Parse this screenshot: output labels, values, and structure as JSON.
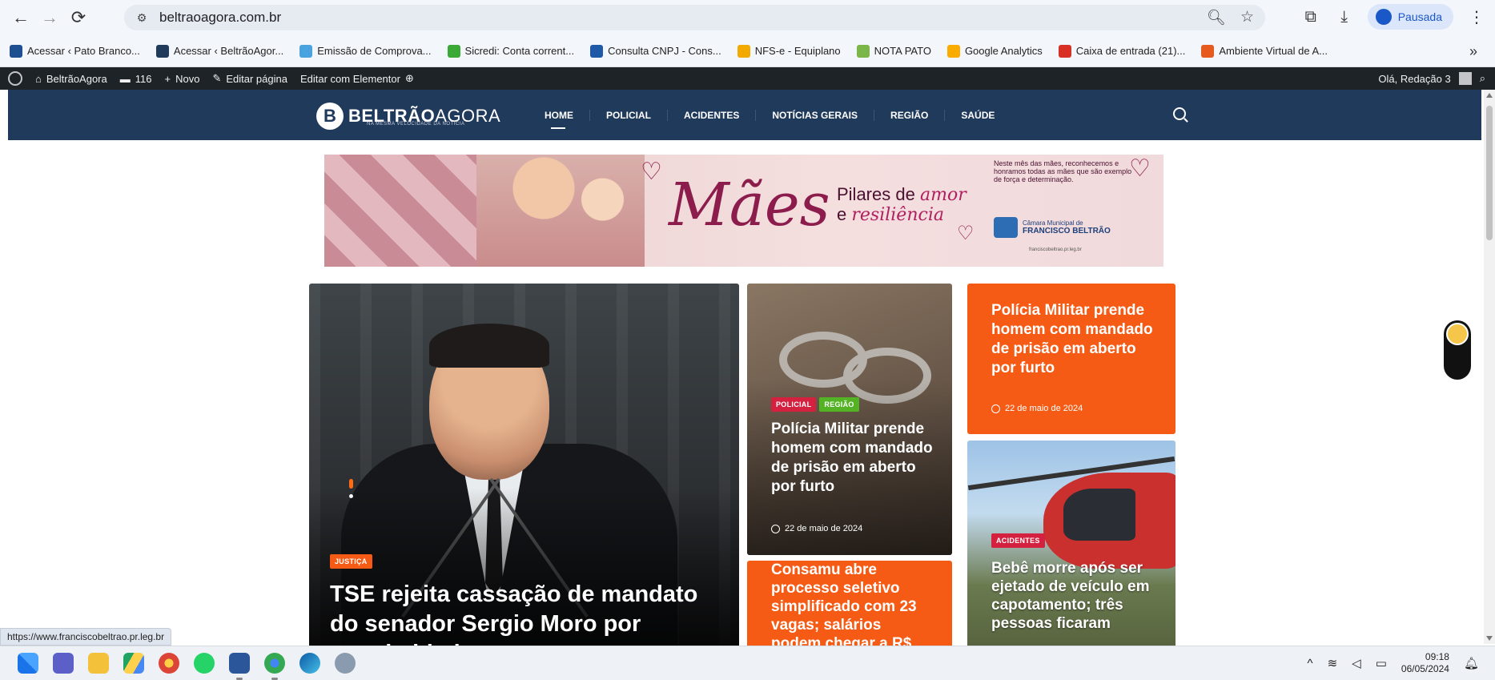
{
  "browser": {
    "url": "beltraoagora.com.br",
    "profile_label": "Pausada",
    "bookmarks": [
      {
        "label": "Acessar ‹ Pato Branco...",
        "color": "#1d4f91"
      },
      {
        "label": "Acessar ‹ BeltrãoAgor...",
        "color": "#203a5c"
      },
      {
        "label": "Emissão de Comprova...",
        "color": "#4aa3df"
      },
      {
        "label": "Sicredi: Conta corrent...",
        "color": "#3aa935"
      },
      {
        "label": "Consulta CNPJ - Cons...",
        "color": "#1e5aa8"
      },
      {
        "label": "NFS-e - Equiplano",
        "color": "#f2a900"
      },
      {
        "label": "NOTA PATO",
        "color": "#7ab648"
      },
      {
        "label": "Google Analytics",
        "color": "#f9ab00"
      },
      {
        "label": "Caixa de entrada (21)...",
        "color": "#d93025"
      },
      {
        "label": "Ambiente Virtual de A...",
        "color": "#e65a1e"
      }
    ]
  },
  "adminbar": {
    "site": "BeltrãoAgora",
    "comments": "116",
    "new": "Novo",
    "edit": "Editar página",
    "elementor": "Editar com Elementor",
    "greeting": "Olá, Redação 3"
  },
  "site": {
    "logo_bold": "BELTRÃO",
    "logo_light": "AGORA",
    "tagline": "NA MESMA VELOCIDADE DA NOTÍCIA",
    "menu": [
      "HOME",
      "POLICIAL",
      "ACIDENTES",
      "NOTÍCIAS GERAIS",
      "REGIÃO",
      "SAÚDE"
    ]
  },
  "banner": {
    "big_word": "Mães",
    "pilares": "Pilares de",
    "amor": "amor",
    "e": "e",
    "resiliencia": "resiliência",
    "description": "Neste mês das mães, reconhecemos e honramos todas as mães que são exemplo de força e determinação.",
    "seal_small": "Câmara Municipal de",
    "seal_name": "FRANCISCO BELTRÃO",
    "seal_url": "franciscobeltrao.pr.leg.br"
  },
  "news": {
    "main": {
      "tag": "JUSTIÇA",
      "title": "TSE rejeita cassação de mandato do senador Sergio Moro por unanimidade"
    },
    "mid": {
      "tags": [
        "POLICIAL",
        "REGIÃO"
      ],
      "title": "Polícia Militar prende homem com mandado de prisão em aberto por furto",
      "date": "22 de maio de 2024"
    },
    "orange1": {
      "title": "Polícia Militar prende homem com mandado de prisão em aberto por furto",
      "date": "22 de maio de 2024"
    },
    "orange2": {
      "title": "Consamu abre processo seletivo simplificado com 23 vagas; salários podem chegar a R$"
    },
    "heli": {
      "tag": "ACIDENTES",
      "title": "Bebê morre após ser ejetado de veículo em capotamento; três pessoas ficaram"
    }
  },
  "status_url": "https://www.franciscobeltrao.pr.leg.br",
  "taskbar": {
    "time": "09:18",
    "date": "06/05/2024"
  }
}
